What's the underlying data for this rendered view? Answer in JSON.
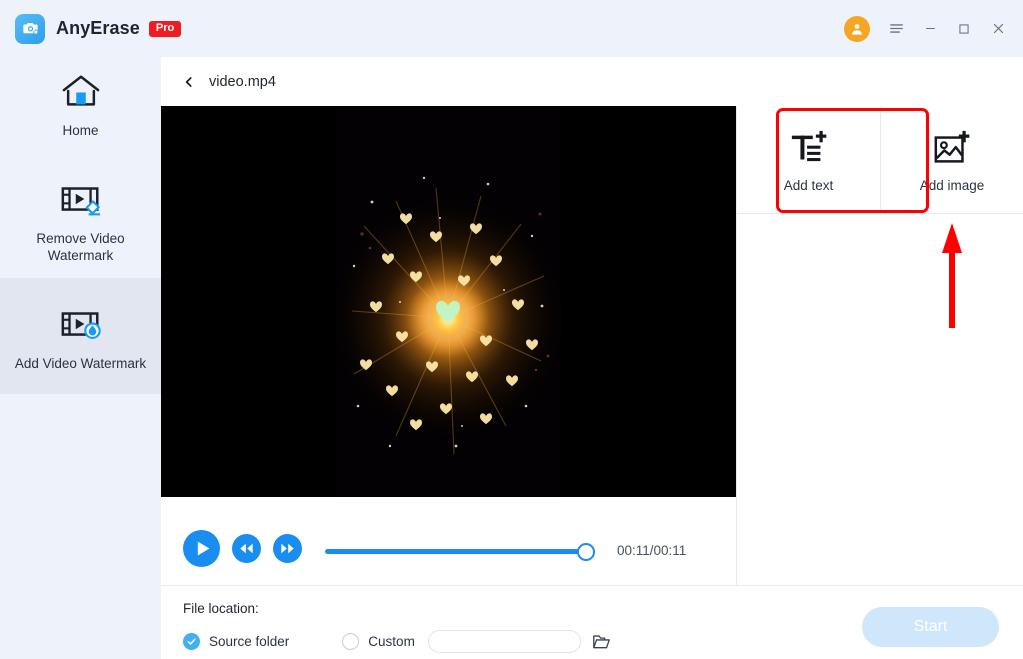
{
  "app": {
    "brand_name": "AnyErase",
    "pro_badge": "Pro",
    "logo_icon": "camera-eraser-icon"
  },
  "titlebar": {
    "avatar_icon": "user-avatar-icon",
    "menu_icon": "hamburger-menu-icon",
    "minimize_icon": "minimize-icon",
    "maximize_icon": "maximize-icon",
    "close_icon": "close-icon"
  },
  "sidebar": {
    "items": [
      {
        "label": "Home",
        "icon": "home-icon",
        "selected": false
      },
      {
        "label": "Remove Video Watermark",
        "icon": "remove-video-watermark-icon",
        "selected": false
      },
      {
        "label": "Add Video Watermark",
        "icon": "add-video-watermark-icon",
        "selected": true
      }
    ]
  },
  "breadcrumb": {
    "back_icon": "chevron-left-icon",
    "title": "video.mp4"
  },
  "player": {
    "play_icon": "play-icon",
    "rewind_icon": "rewind-icon",
    "forward_icon": "fast-forward-icon",
    "time": "00:11/00:11",
    "progress_percent": 100
  },
  "tools": {
    "add_text": {
      "label": "Add text",
      "icon": "add-text-icon"
    },
    "add_image": {
      "label": "Add image",
      "icon": "add-image-icon",
      "highlighted": true
    }
  },
  "annotation": {
    "highlight_color": "#fe0000",
    "arrow_icon": "up-arrow-annotation",
    "target": "Add image"
  },
  "footer": {
    "file_location_label": "File location:",
    "source_folder_label": "Source folder",
    "source_folder_selected": true,
    "custom_label": "Custom",
    "custom_selected": false,
    "custom_path_value": "",
    "custom_path_placeholder": "",
    "browse_icon": "folder-icon",
    "start_label": "Start"
  },
  "colors": {
    "accent_blue": "#1a8ef0",
    "sidebar_bg": "#eef2fb",
    "pro_red": "#ee1c23",
    "highlight_red": "#fe0000",
    "start_disabled": "#cfe7fb",
    "avatar_orange": "#f5a623"
  }
}
